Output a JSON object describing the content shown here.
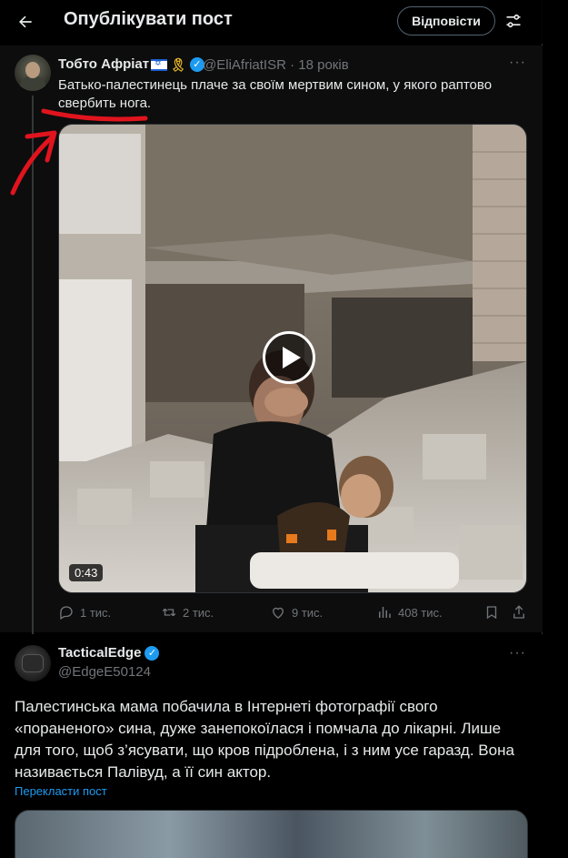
{
  "header": {
    "title": "Опублікувати пост",
    "reply_label": "Відповісти",
    "icons": {
      "back": "arrow-left-icon",
      "settings": "sliders-icon"
    }
  },
  "tweet1": {
    "author_name": "Тобто Афріат",
    "handle": "@EliAfriatISR",
    "time_ago": "18 років",
    "text": "Батько-палестинець плаче за своїм мертвим сином, у якого раптово свербить нога.",
    "video_duration": "0:43",
    "stats": {
      "replies": "1 тис.",
      "reposts": "2 тис.",
      "likes": "9 тис.",
      "views": "408 тис."
    },
    "annotation_color": "#e0141e"
  },
  "tweet2": {
    "author_name": "TacticalEdge",
    "handle": "@EdgeE50124",
    "text": "Палестинська мама побачила в Інтернеті фотографії свого «пораненого» сина, дуже занепокоїлася і помчала до лікарні. Лише для того, щоб з’ясувати, що кров підроблена, і з ним усе гаразд. Вона називається Палівуд, а її син актор.",
    "translate_label": "Перекласти пост"
  },
  "colors": {
    "accent": "#1d9bf0",
    "verified": "#1d9bf0",
    "secondary_text": "#71767b",
    "primary_text": "#e7e9ea"
  }
}
